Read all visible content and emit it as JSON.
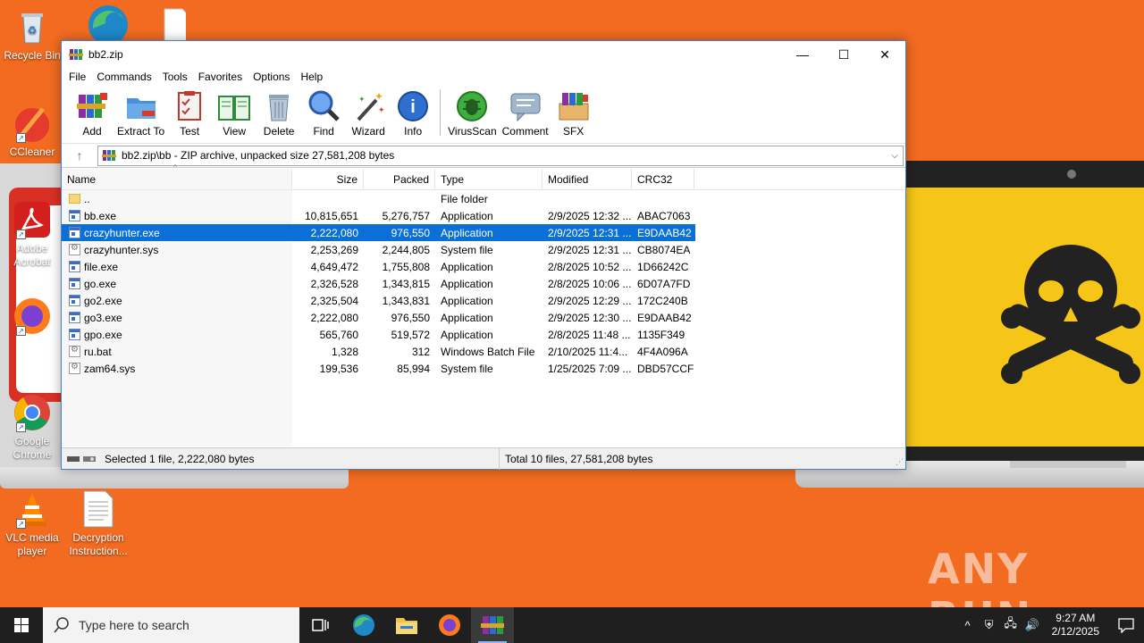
{
  "desktop": {
    "icons": [
      {
        "label": "Recycle Bin"
      },
      {
        "label": "CCleaner"
      },
      {
        "label": "Adobe Acrobat"
      },
      {
        "label": "Google Chrome"
      },
      {
        "label": "VLC media player"
      },
      {
        "label": "Decryption Instruction..."
      }
    ],
    "watermark": "ANY RUN"
  },
  "window": {
    "title": "bb2.zip",
    "menu": [
      "File",
      "Commands",
      "Tools",
      "Favorites",
      "Options",
      "Help"
    ],
    "toolbar": [
      "Add",
      "Extract To",
      "Test",
      "View",
      "Delete",
      "Find",
      "Wizard",
      "Info",
      "VirusScan",
      "Comment",
      "SFX"
    ],
    "path": "bb2.zip\\bb - ZIP archive, unpacked size 27,581,208 bytes",
    "columns": [
      "Name",
      "Size",
      "Packed",
      "Type",
      "Modified",
      "CRC32"
    ],
    "files": [
      {
        "name": "..",
        "size": "",
        "packed": "",
        "type": "File folder",
        "modified": "",
        "crc": "",
        "icon": "folder"
      },
      {
        "name": "bb.exe",
        "size": "10,815,651",
        "packed": "5,276,757",
        "type": "Application",
        "modified": "2/9/2025 12:32 ...",
        "crc": "ABAC7063",
        "icon": "app"
      },
      {
        "name": "crazyhunter.exe",
        "size": "2,222,080",
        "packed": "976,550",
        "type": "Application",
        "modified": "2/9/2025 12:31 ...",
        "crc": "E9DAAB42",
        "icon": "app",
        "selected": true
      },
      {
        "name": "crazyhunter.sys",
        "size": "2,253,269",
        "packed": "2,244,805",
        "type": "System file",
        "modified": "2/9/2025 12:31 ...",
        "crc": "CB8074EA",
        "icon": "sys"
      },
      {
        "name": "file.exe",
        "size": "4,649,472",
        "packed": "1,755,808",
        "type": "Application",
        "modified": "2/8/2025 10:52 ...",
        "crc": "1D66242C",
        "icon": "app"
      },
      {
        "name": "go.exe",
        "size": "2,326,528",
        "packed": "1,343,815",
        "type": "Application",
        "modified": "2/8/2025 10:06 ...",
        "crc": "6D07A7FD",
        "icon": "app"
      },
      {
        "name": "go2.exe",
        "size": "2,325,504",
        "packed": "1,343,831",
        "type": "Application",
        "modified": "2/9/2025 12:29 ...",
        "crc": "172C240B",
        "icon": "app"
      },
      {
        "name": "go3.exe",
        "size": "2,222,080",
        "packed": "976,550",
        "type": "Application",
        "modified": "2/9/2025 12:30 ...",
        "crc": "E9DAAB42",
        "icon": "app"
      },
      {
        "name": "gpo.exe",
        "size": "565,760",
        "packed": "519,572",
        "type": "Application",
        "modified": "2/8/2025 11:48 ...",
        "crc": "1135F349",
        "icon": "app"
      },
      {
        "name": "ru.bat",
        "size": "1,328",
        "packed": "312",
        "type": "Windows Batch File",
        "modified": "2/10/2025 11:4...",
        "crc": "4F4A096A",
        "icon": "sys"
      },
      {
        "name": "zam64.sys",
        "size": "199,536",
        "packed": "85,994",
        "type": "System file",
        "modified": "1/25/2025 7:09 ...",
        "crc": "DBD57CCF",
        "icon": "sys"
      }
    ],
    "status_left": "Selected 1 file, 2,222,080 bytes",
    "status_right": "Total 10 files, 27,581,208 bytes"
  },
  "taskbar": {
    "search_placeholder": "Type here to search",
    "time": "9:27 AM",
    "date": "2/12/2025"
  },
  "colors": {
    "selection": "#0a6fd6",
    "wallpaper": "#f26b21"
  }
}
